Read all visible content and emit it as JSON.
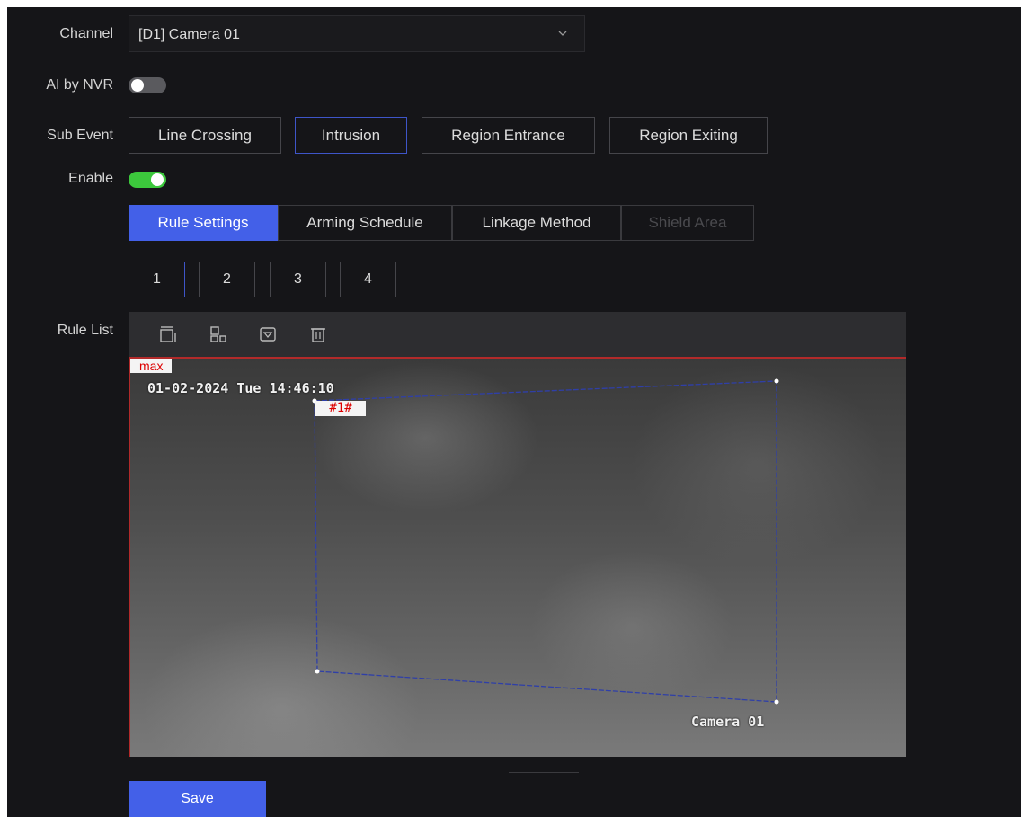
{
  "labels": {
    "channel": "Channel",
    "ai_by_nvr": "AI by NVR",
    "sub_event": "Sub Event",
    "enable": "Enable",
    "rule_list": "Rule List"
  },
  "channel": {
    "value": "[D1] Camera 01"
  },
  "toggles": {
    "ai_by_nvr": false,
    "enable": true
  },
  "sub_events": [
    {
      "label": "Line Crossing",
      "selected": false
    },
    {
      "label": "Intrusion",
      "selected": true
    },
    {
      "label": "Region Entrance",
      "selected": false
    },
    {
      "label": "Region Exiting",
      "selected": false
    }
  ],
  "tabs": [
    {
      "label": "Rule Settings",
      "state": "active"
    },
    {
      "label": "Arming Schedule",
      "state": "normal"
    },
    {
      "label": "Linkage Method",
      "state": "normal"
    },
    {
      "label": "Shield Area",
      "state": "disabled"
    }
  ],
  "rule_numbers": [
    "1",
    "2",
    "3",
    "4"
  ],
  "selected_rule": "1",
  "toolbar_icons": [
    "draw-area-icon",
    "max-size-icon",
    "min-size-icon",
    "delete-icon"
  ],
  "video": {
    "max_tag": "max",
    "timestamp": "01-02-2024 Tue 14:46:10",
    "region_label": "#1#",
    "camera_name": "Camera 01"
  },
  "save_label": "Save",
  "colors": {
    "accent": "#4360e8",
    "toggle_on": "#3cc83c",
    "toggle_off": "#5a5a5e",
    "region_line": "#2f3fa8",
    "alert_red": "#d00000"
  }
}
